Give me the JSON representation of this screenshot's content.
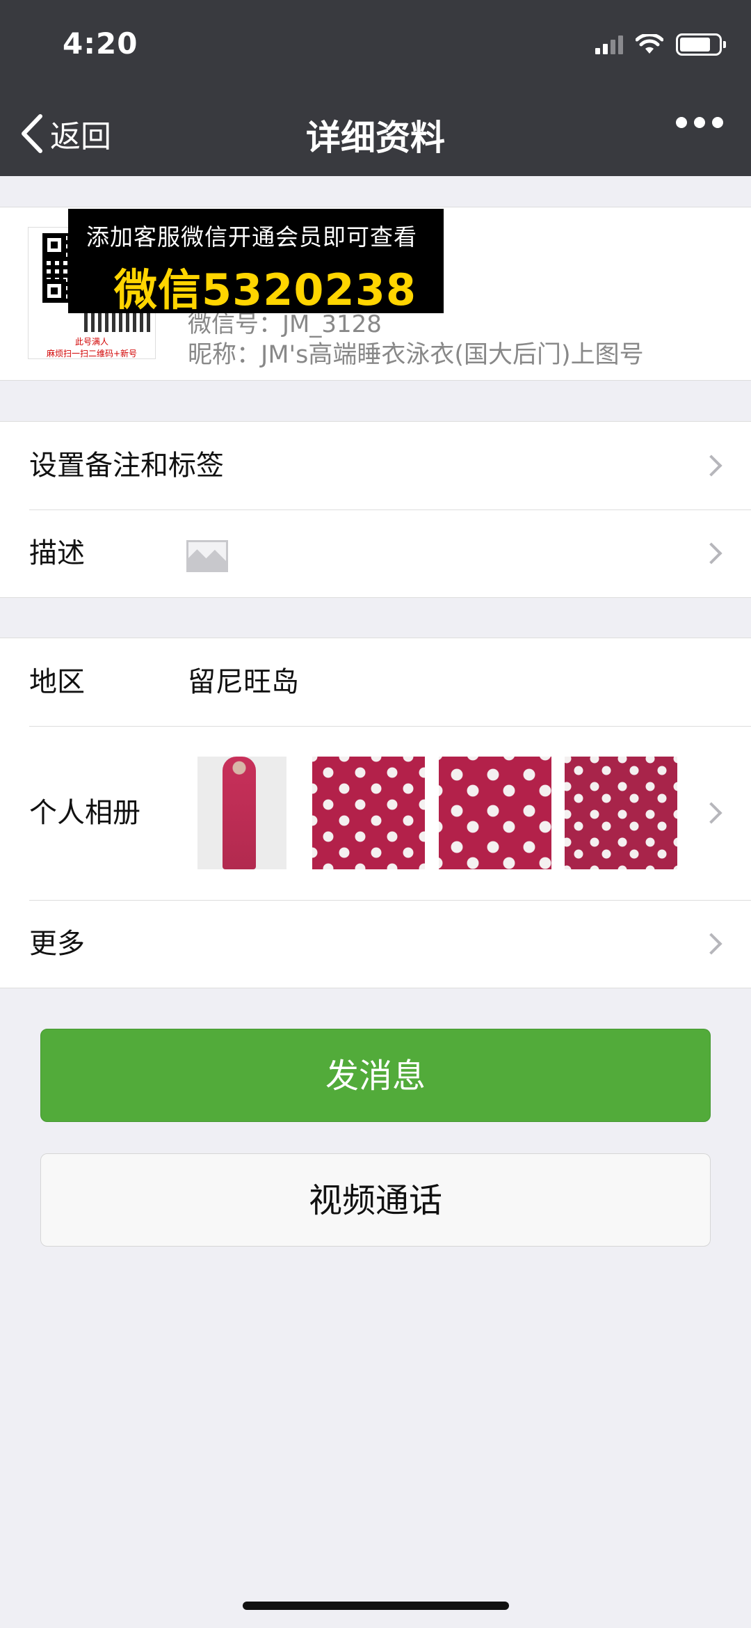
{
  "status_bar": {
    "time": "4:20"
  },
  "nav": {
    "back_label": "返回",
    "title": "详细资料"
  },
  "profile": {
    "avatar_caption_1": "此号满人",
    "avatar_caption_2": "麻烦扫一扫二维码+新号",
    "wechat_id": "微信号：JM_3128",
    "nickname": "昵称：JM's高端睡衣泳衣(国大后门)上图号"
  },
  "promo_overlay": {
    "line1": "添加客服微信开通会员即可查看",
    "line2": "微信5320238"
  },
  "group1": {
    "remark_label": "设置备注和标签",
    "description_label": "描述"
  },
  "group2": {
    "region_label": "地区",
    "region_value": "留尼旺岛",
    "album_label": "个人相册",
    "more_label": "更多"
  },
  "actions": {
    "send_message": "发消息",
    "video_call": "视频通话"
  },
  "colors": {
    "header_bg": "#393a3f",
    "primary_green": "#52ab3a",
    "promo_yellow": "#ffd500",
    "page_bg": "#efeff4"
  }
}
